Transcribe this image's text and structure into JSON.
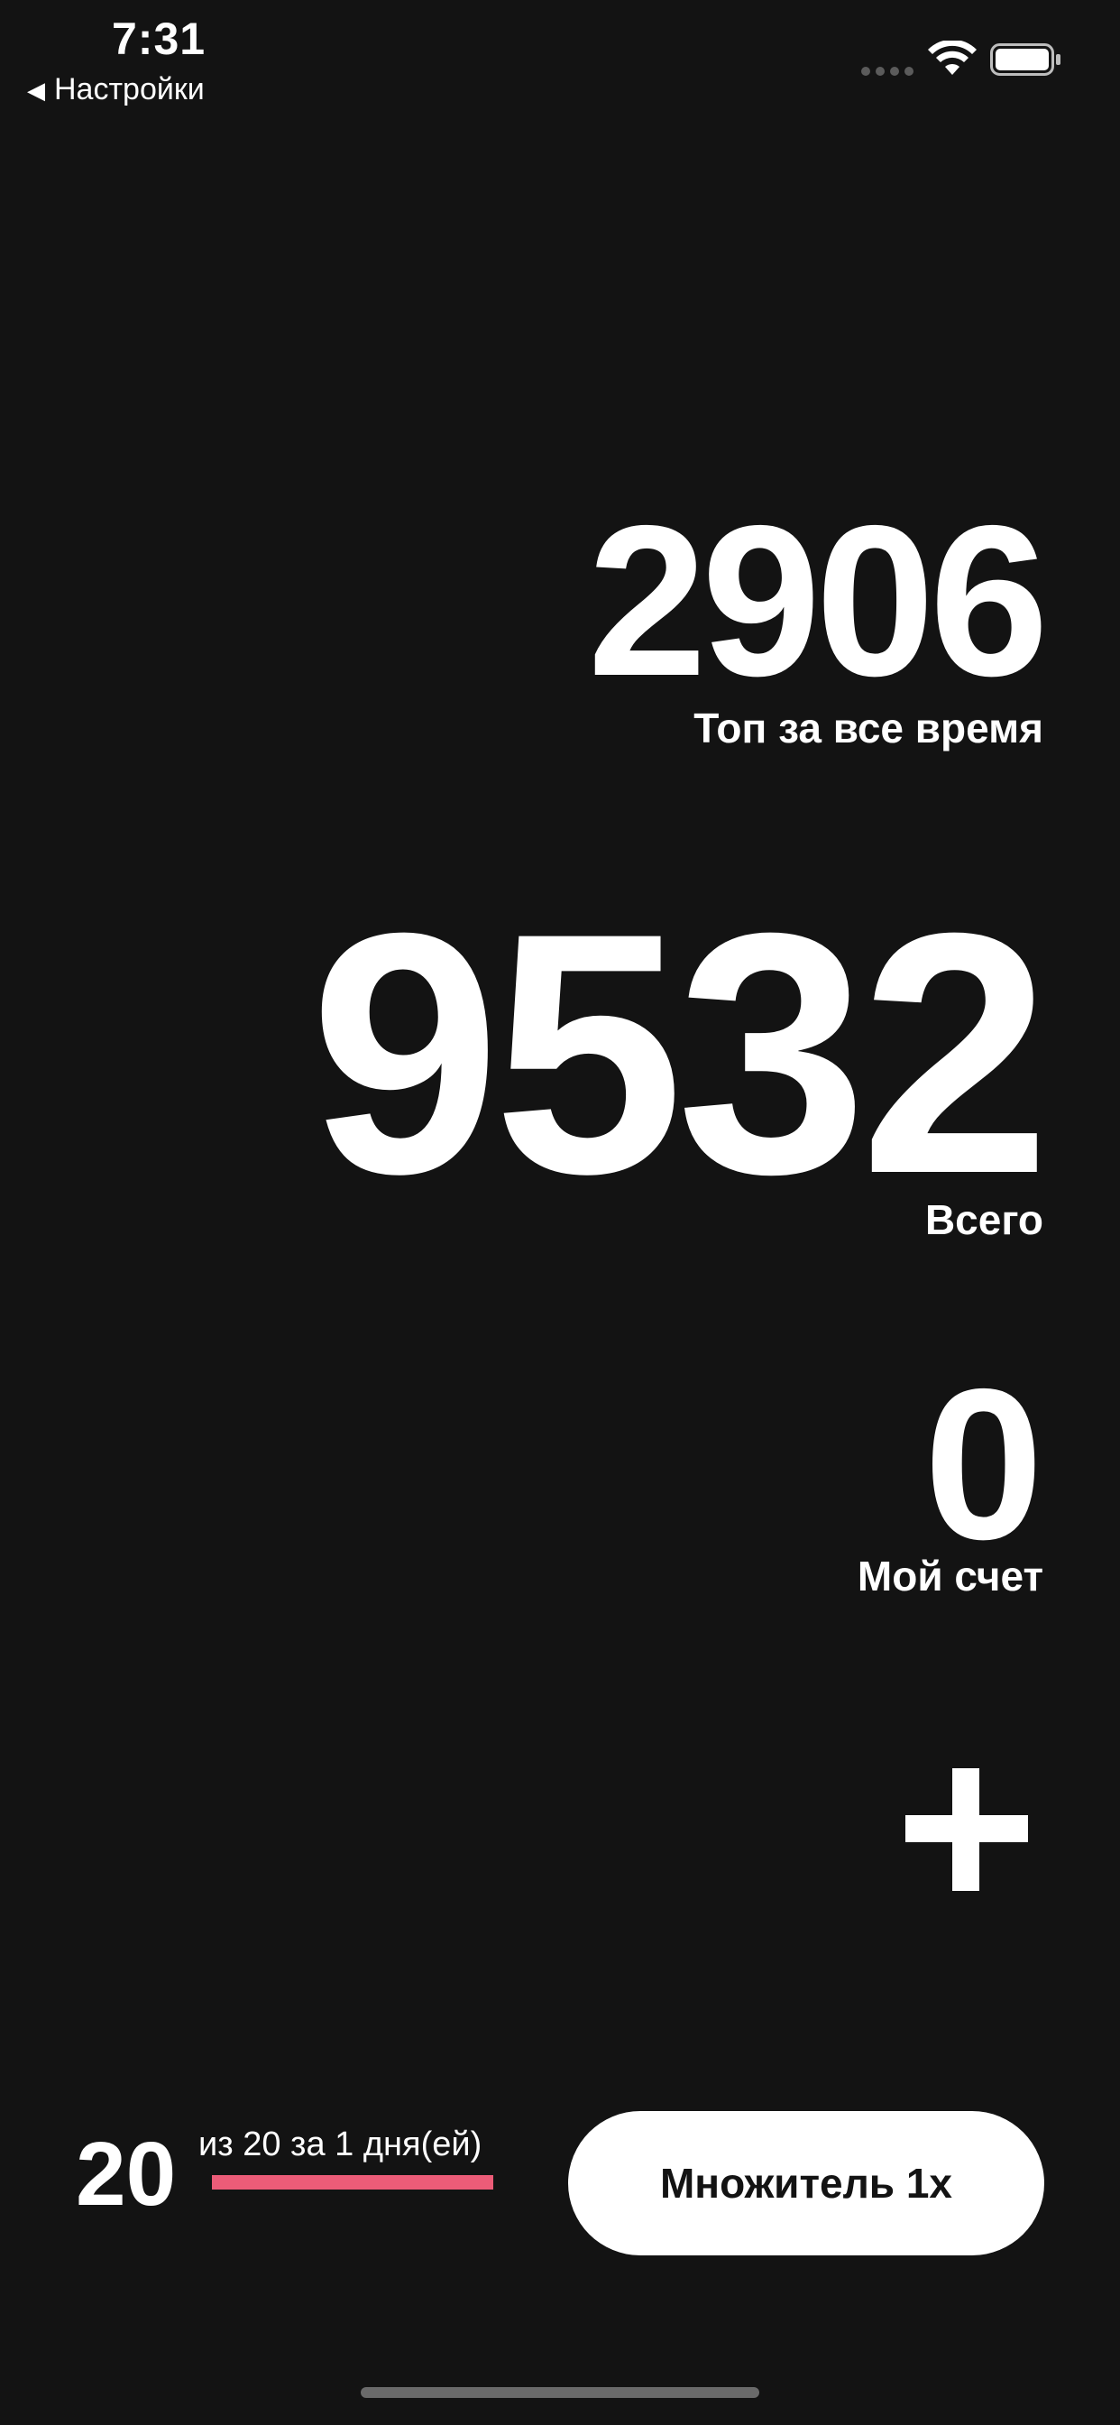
{
  "status_bar": {
    "time": "7:31",
    "back_label": "Настройки",
    "icons": [
      "signal-dots-icon",
      "wifi-icon",
      "battery-icon"
    ]
  },
  "stats": {
    "top": {
      "value": "2906",
      "label": "Топ за все время"
    },
    "total": {
      "value": "9532",
      "label": "Всего"
    },
    "my": {
      "value": "0",
      "label": "Мой счет"
    }
  },
  "add_button": {
    "icon": "plus-icon"
  },
  "daily": {
    "count": "20",
    "caption": "из 20 за 1 дня(ей)",
    "progress": 1.0
  },
  "multiplier_button": {
    "label": "Множитель 1x"
  },
  "colors": {
    "background": "#131313",
    "text": "#ffffff",
    "accent": "#ec5c78"
  }
}
